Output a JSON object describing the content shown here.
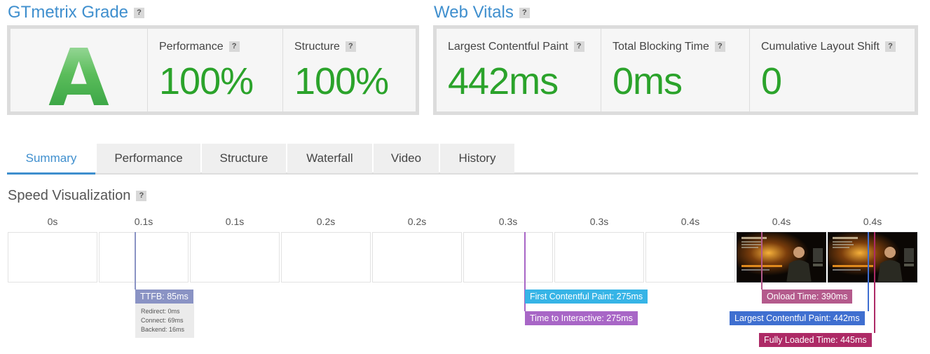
{
  "grade": {
    "title": "GTmetrix Grade",
    "help": "?",
    "letter": "A",
    "metrics": [
      {
        "label": "Performance",
        "value": "100%"
      },
      {
        "label": "Structure",
        "value": "100%"
      }
    ]
  },
  "web_vitals": {
    "title": "Web Vitals",
    "help": "?",
    "metrics": [
      {
        "label": "Largest Contentful Paint",
        "value": "442ms"
      },
      {
        "label": "Total Blocking Time",
        "value": "0ms"
      },
      {
        "label": "Cumulative Layout Shift",
        "value": "0"
      }
    ]
  },
  "tabs": [
    "Summary",
    "Performance",
    "Structure",
    "Waterfall",
    "Video",
    "History"
  ],
  "active_tab": "Summary",
  "speed": {
    "title": "Speed Visualization",
    "help": "?",
    "ticks": [
      "0s",
      "0.1s",
      "0.1s",
      "0.2s",
      "0.2s",
      "0.3s",
      "0.3s",
      "0.4s",
      "0.4s",
      "0.4s"
    ],
    "frames_with_screenshot": [
      8,
      9
    ],
    "markers": {
      "ttfb": "TTFB: 85ms",
      "ttfb_details": [
        "Redirect: 0ms",
        "Connect: 69ms",
        "Backend: 16ms"
      ],
      "fcp": "First Contentful Paint: 275ms",
      "tti": "Time to Interactive: 275ms",
      "onload": "Onload Time: 390ms",
      "lcp": "Largest Contentful Paint: 442ms",
      "fully_loaded": "Fully Loaded Time: 445ms"
    }
  },
  "colors": {
    "accent": "#3f8fce",
    "good": "#2ba32b",
    "ttfb": "#8a93c4",
    "fcp": "#36b4e6",
    "tti": "#a866c6",
    "onload": "#b45a8c",
    "lcp": "#3f6fd0",
    "fully_loaded": "#ad2a66"
  }
}
